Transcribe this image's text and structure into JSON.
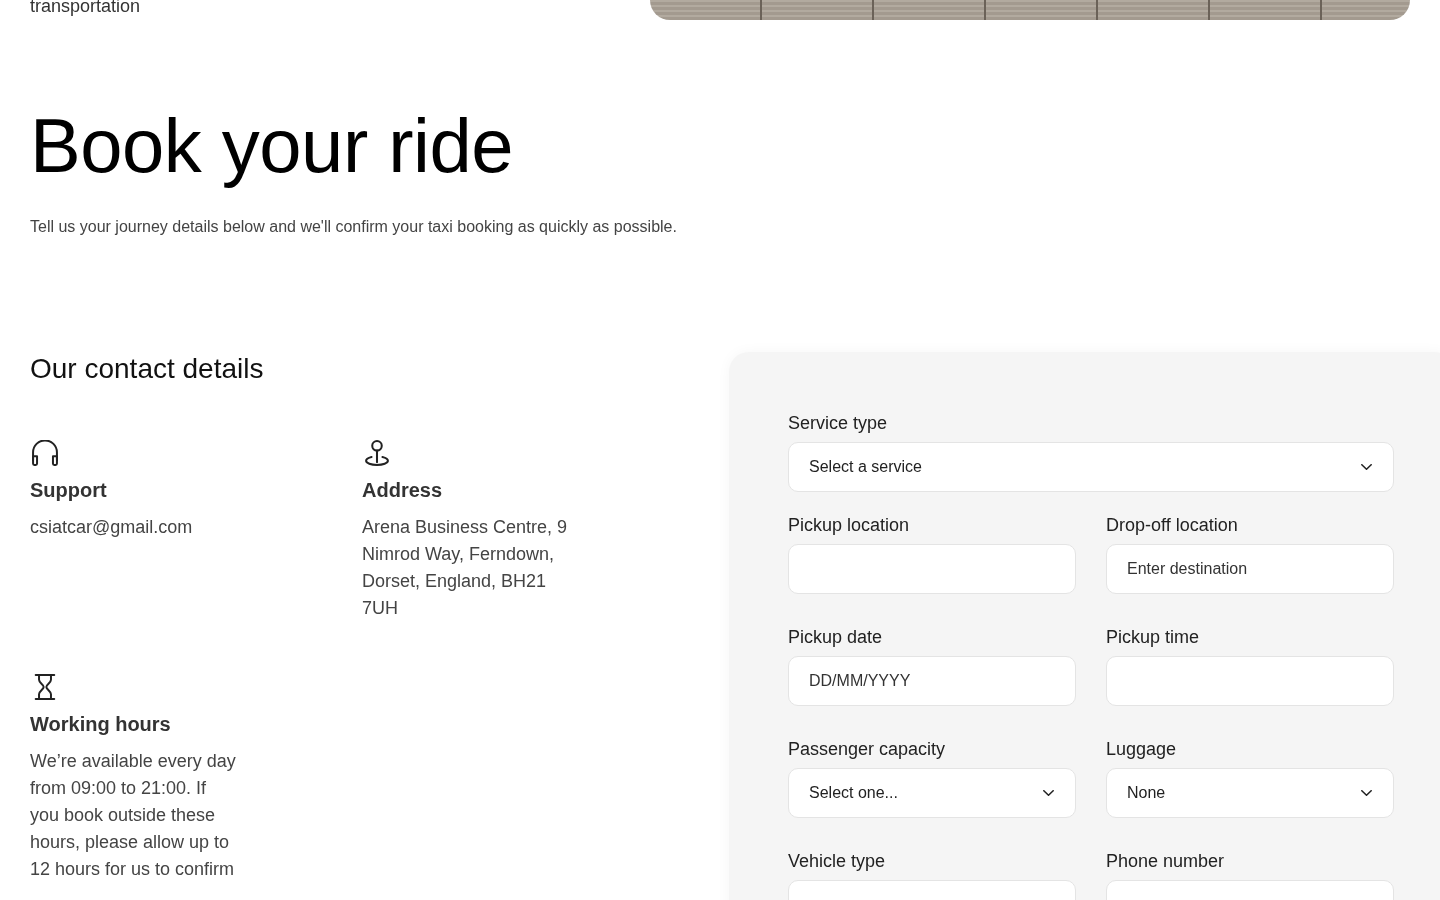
{
  "header": {
    "tagline": "transportation"
  },
  "hero": {
    "title": "Book your ride",
    "subtitle": "Tell us your journey details below and we'll confirm your taxi booking as quickly as possible."
  },
  "contact": {
    "title": "Our contact details",
    "items": [
      {
        "kind": "support",
        "title": "Support",
        "text": "csiatcar@gmail.com"
      },
      {
        "kind": "address",
        "title": "Address",
        "text": "Arena Business Centre, 9 Nimrod Way, Ferndown, Dorset, England, BH21 7UH"
      },
      {
        "kind": "hours",
        "title": "Working hours",
        "text": "We’re available every day from 09:00 to 21:00. If you book outside these hours, please allow up to 12 hours for us to confirm"
      }
    ]
  },
  "form": {
    "rows": [
      [
        {
          "label": "Service type",
          "kind": "select",
          "value": "Select a service"
        }
      ],
      [
        {
          "label": "Pickup location",
          "kind": "input"
        },
        {
          "label": "Drop-off location",
          "kind": "input",
          "placeholder": "Enter destination"
        }
      ],
      [
        {
          "label": "Pickup date",
          "kind": "input",
          "placeholder": "DD/MM/YYYY"
        },
        {
          "label": "Pickup time",
          "kind": "input"
        }
      ],
      [
        {
          "label": "Passenger capacity",
          "kind": "select",
          "value": "Select one..."
        },
        {
          "label": "Luggage",
          "kind": "select",
          "value": "None"
        }
      ],
      [
        {
          "label": "Vehicle type",
          "kind": "input"
        },
        {
          "label": "Phone number",
          "kind": "input"
        }
      ]
    ]
  }
}
